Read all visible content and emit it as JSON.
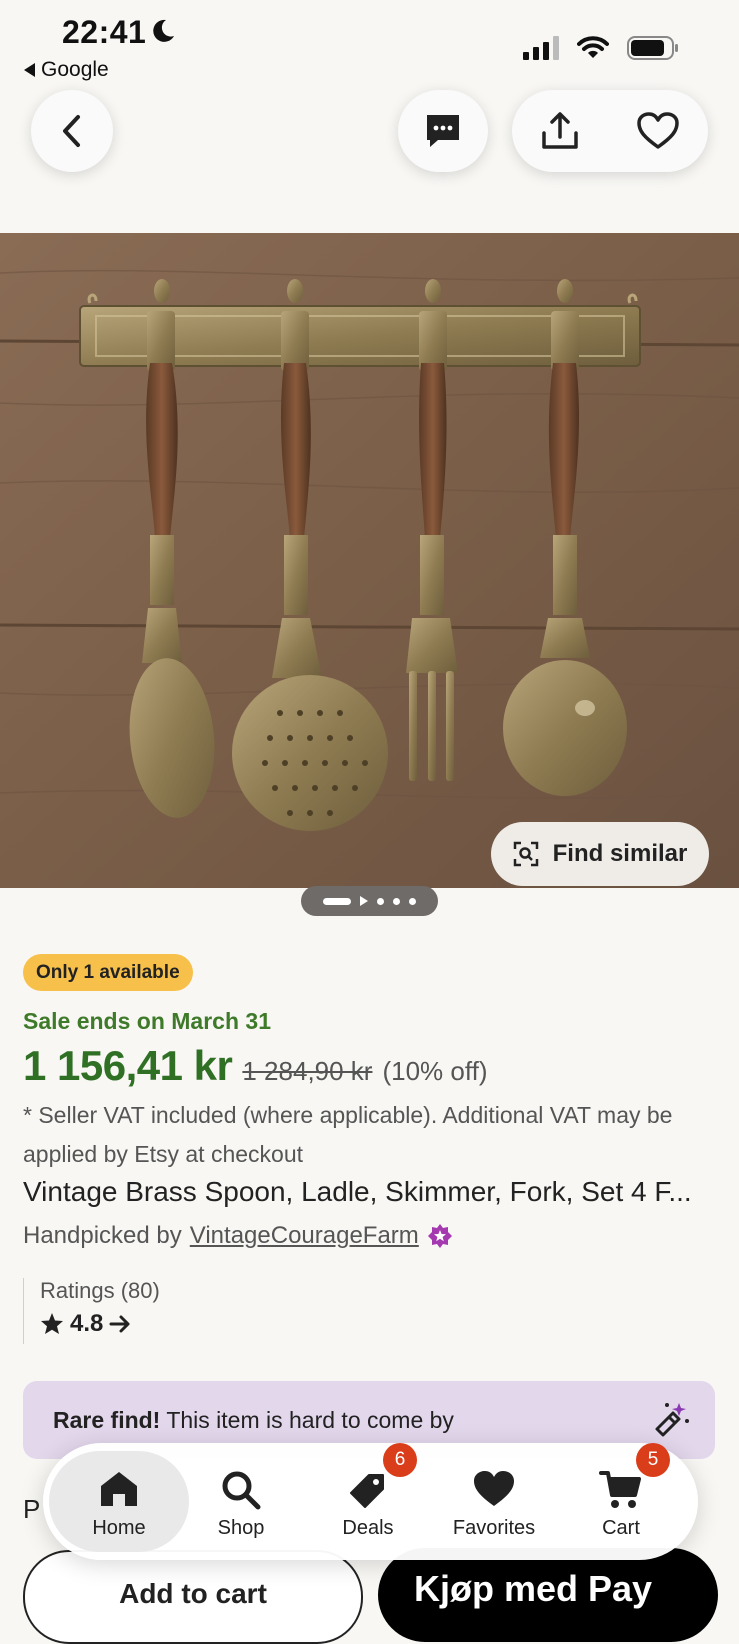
{
  "status_bar": {
    "time": "22:41",
    "back_app": "Google"
  },
  "header": {
    "icons": [
      "back-arrow",
      "message",
      "share",
      "heart"
    ]
  },
  "gallery": {
    "find_similar": "Find similar",
    "pages": 5
  },
  "product": {
    "availability": "Only 1 available",
    "sale_ends": "Sale ends on March 31",
    "price": "1 156,41 kr",
    "original_price": "1 284,90 kr",
    "discount": "(10% off)",
    "vat_note": "* Seller VAT included (where applicable). Additional VAT may be applied by Etsy at checkout",
    "title": "Vintage Brass Spoon, Ladle, Skimmer, Fork, Set 4 F...",
    "handpicked_prefix": "Handpicked by",
    "shop_name": "VintageCourageFarm",
    "ratings_label": "Ratings (80)",
    "rating": "4.8"
  },
  "rare_find": {
    "bold": "Rare find!",
    "text": "This item is hard to come by"
  },
  "peek_text": "P",
  "cta": {
    "add_to_cart": "Add to cart",
    "apple_pay": "Kjøp med  Pay"
  },
  "tabbar": {
    "items": [
      {
        "label": "Home",
        "icon": "home-icon",
        "active": true
      },
      {
        "label": "Shop",
        "icon": "search-icon"
      },
      {
        "label": "Deals",
        "icon": "tag-icon",
        "badge": "6"
      },
      {
        "label": "Favorites",
        "icon": "heart-icon"
      },
      {
        "label": "Cart",
        "icon": "cart-icon",
        "badge": "5"
      }
    ]
  },
  "colors": {
    "sale_green": "#2f7024",
    "badge_yellow": "#f7c04a",
    "rare_purple": "#e3d7ec",
    "tab_badge": "#d93d1a"
  }
}
